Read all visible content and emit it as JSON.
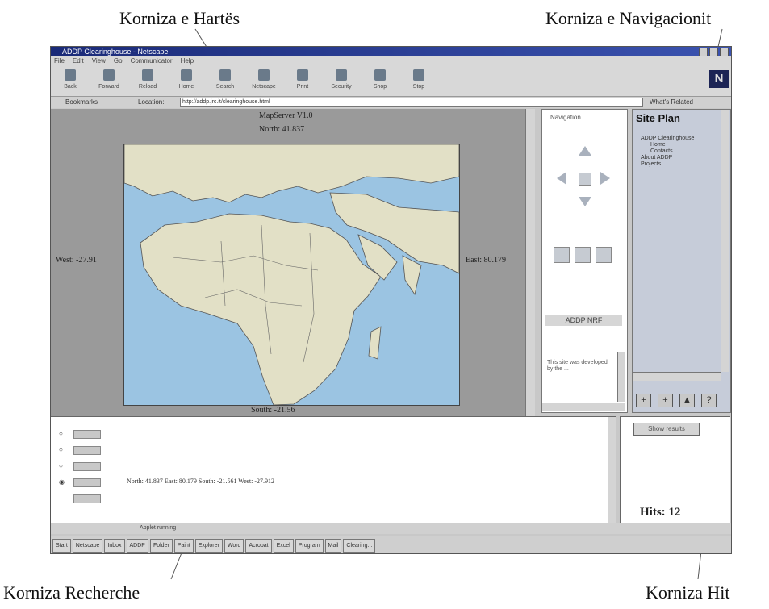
{
  "callouts": {
    "map_frame": "Korniza e Hartës",
    "nav_frame": "Korniza e Navigacionit",
    "search_frame": "Korniza Recherche",
    "hit_frame": "Korniza Hit"
  },
  "window": {
    "title": "ADDP Clearinghouse - Netscape",
    "menu": [
      "File",
      "Edit",
      "View",
      "Go",
      "Communicator",
      "Help"
    ],
    "toolbar": [
      "Back",
      "Forward",
      "Reload",
      "Home",
      "Search",
      "Netscape",
      "Print",
      "Security",
      "Shop",
      "Stop"
    ],
    "location_labels": {
      "bookmarks": "Bookmarks",
      "location": "Location:",
      "related": "What's Related"
    },
    "url": "http://addp.jrc.it/clearinghouse.html"
  },
  "map": {
    "viewer": "MapServer V1.0",
    "north": "North: 41.837",
    "west": "West: -27.91",
    "east": "East: 80.179",
    "south": "South: -21.56"
  },
  "navigation": {
    "title": "Navigation",
    "brand": "ADDP  NRF",
    "text": "This site was developed by the ..."
  },
  "site_plan": {
    "title": "Site Plan",
    "tree": [
      "ADDP Clearinghouse",
      "Home",
      "Contacts",
      "About ADDP",
      "Projects"
    ],
    "buttons": [
      "+",
      "+",
      "▲",
      "?"
    ]
  },
  "search": {
    "coords": "North: 41.837 East: 80.179 South: -21.561 West: -27.912"
  },
  "hit": {
    "show_results": "Show results",
    "hits": "Hits: 12"
  },
  "status": {
    "text": "Applet running"
  },
  "taskbar": [
    "Start",
    "Netscape",
    "Inbox",
    "ADDP",
    "Folder",
    "Paint",
    "Explorer",
    "Word",
    "Acrobat",
    "Excel",
    "Program",
    "Mail",
    "Clearing..."
  ]
}
